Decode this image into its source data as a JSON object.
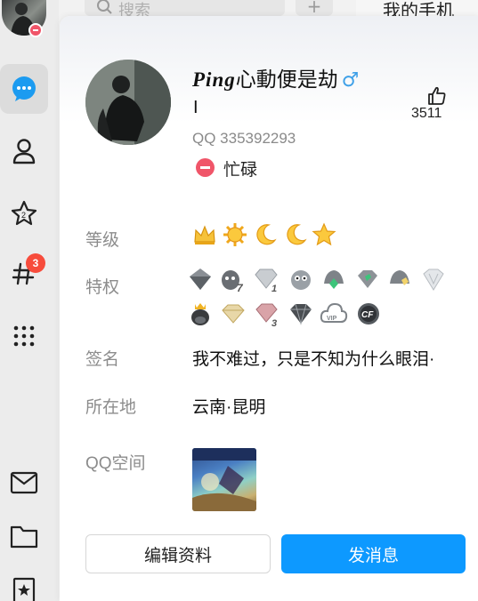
{
  "search": {
    "placeholder": "搜索",
    "plus": "+"
  },
  "header": {
    "title": "我的手机"
  },
  "rail": {
    "badge_count": "3"
  },
  "profile": {
    "nickname_latin": "Ping",
    "nickname_cn": "心動便是劫",
    "gender_symbol": "♂",
    "mark": "I",
    "qq_number": "QQ 335392293",
    "status": "忙碌",
    "likes": "3511"
  },
  "rows": {
    "level_label": "等级",
    "privilege_label": "特权",
    "signature_label": "签名",
    "signature_value": "我不难过，只是不知为什么眼泪·",
    "location_label": "所在地",
    "location_value": "云南·昆明",
    "zone_label": "QQ空间"
  },
  "level_icons": [
    "crown-icon",
    "sun-icon",
    "moon-icon",
    "moon-icon",
    "star-icon"
  ],
  "privilege_icons": [
    "vip-diamond-icon",
    "super-member-icon-7",
    "diamond-icon-1",
    "penguin-icon",
    "green-diamond-icon",
    "green-gem-icon",
    "yellow-diamond-icon",
    "white-gem-icon",
    "penguin-crown-icon",
    "gold-diamond-icon",
    "pink-diamond-icon-3",
    "black-diamond-icon",
    "vip-cloud-icon",
    "cf-icon"
  ],
  "colors": {
    "primary": "#0d99ff",
    "status": "#f05569",
    "gender": "#3fa0e8",
    "badge": "#f74c3c"
  },
  "buttons": {
    "edit": "编辑资料",
    "message": "发消息"
  }
}
